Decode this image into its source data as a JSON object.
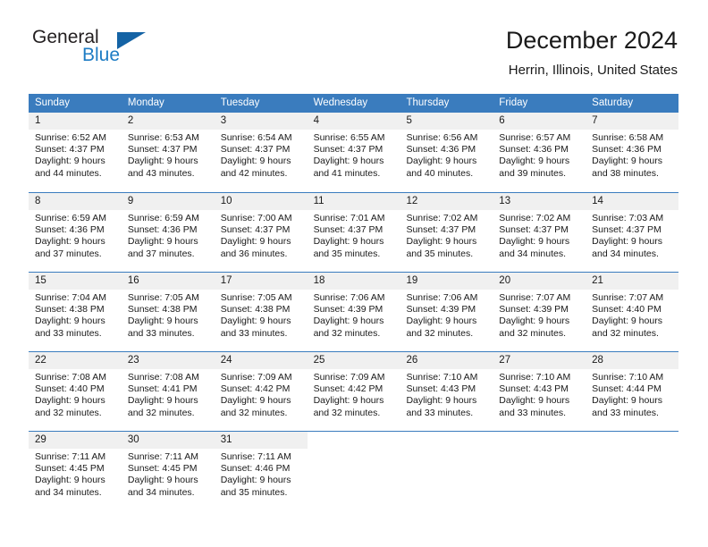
{
  "brand": {
    "name_part1": "General",
    "name_part2": "Blue",
    "logo_icon": "triangle-logo-icon",
    "accent_color": "#1463a5"
  },
  "header": {
    "title": "December 2024",
    "location": "Herrin, Illinois, United States"
  },
  "calendar": {
    "header_bg_color": "#3a7cbe",
    "day_band_color": "#f0f0f0",
    "weekdays": [
      "Sunday",
      "Monday",
      "Tuesday",
      "Wednesday",
      "Thursday",
      "Friday",
      "Saturday"
    ],
    "weeks": [
      [
        {
          "day": "1",
          "lines": [
            "Sunrise: 6:52 AM",
            "Sunset: 4:37 PM",
            "Daylight: 9 hours",
            "and 44 minutes."
          ]
        },
        {
          "day": "2",
          "lines": [
            "Sunrise: 6:53 AM",
            "Sunset: 4:37 PM",
            "Daylight: 9 hours",
            "and 43 minutes."
          ]
        },
        {
          "day": "3",
          "lines": [
            "Sunrise: 6:54 AM",
            "Sunset: 4:37 PM",
            "Daylight: 9 hours",
            "and 42 minutes."
          ]
        },
        {
          "day": "4",
          "lines": [
            "Sunrise: 6:55 AM",
            "Sunset: 4:37 PM",
            "Daylight: 9 hours",
            "and 41 minutes."
          ]
        },
        {
          "day": "5",
          "lines": [
            "Sunrise: 6:56 AM",
            "Sunset: 4:36 PM",
            "Daylight: 9 hours",
            "and 40 minutes."
          ]
        },
        {
          "day": "6",
          "lines": [
            "Sunrise: 6:57 AM",
            "Sunset: 4:36 PM",
            "Daylight: 9 hours",
            "and 39 minutes."
          ]
        },
        {
          "day": "7",
          "lines": [
            "Sunrise: 6:58 AM",
            "Sunset: 4:36 PM",
            "Daylight: 9 hours",
            "and 38 minutes."
          ]
        }
      ],
      [
        {
          "day": "8",
          "lines": [
            "Sunrise: 6:59 AM",
            "Sunset: 4:36 PM",
            "Daylight: 9 hours",
            "and 37 minutes."
          ]
        },
        {
          "day": "9",
          "lines": [
            "Sunrise: 6:59 AM",
            "Sunset: 4:36 PM",
            "Daylight: 9 hours",
            "and 37 minutes."
          ]
        },
        {
          "day": "10",
          "lines": [
            "Sunrise: 7:00 AM",
            "Sunset: 4:37 PM",
            "Daylight: 9 hours",
            "and 36 minutes."
          ]
        },
        {
          "day": "11",
          "lines": [
            "Sunrise: 7:01 AM",
            "Sunset: 4:37 PM",
            "Daylight: 9 hours",
            "and 35 minutes."
          ]
        },
        {
          "day": "12",
          "lines": [
            "Sunrise: 7:02 AM",
            "Sunset: 4:37 PM",
            "Daylight: 9 hours",
            "and 35 minutes."
          ]
        },
        {
          "day": "13",
          "lines": [
            "Sunrise: 7:02 AM",
            "Sunset: 4:37 PM",
            "Daylight: 9 hours",
            "and 34 minutes."
          ]
        },
        {
          "day": "14",
          "lines": [
            "Sunrise: 7:03 AM",
            "Sunset: 4:37 PM",
            "Daylight: 9 hours",
            "and 34 minutes."
          ]
        }
      ],
      [
        {
          "day": "15",
          "lines": [
            "Sunrise: 7:04 AM",
            "Sunset: 4:38 PM",
            "Daylight: 9 hours",
            "and 33 minutes."
          ]
        },
        {
          "day": "16",
          "lines": [
            "Sunrise: 7:05 AM",
            "Sunset: 4:38 PM",
            "Daylight: 9 hours",
            "and 33 minutes."
          ]
        },
        {
          "day": "17",
          "lines": [
            "Sunrise: 7:05 AM",
            "Sunset: 4:38 PM",
            "Daylight: 9 hours",
            "and 33 minutes."
          ]
        },
        {
          "day": "18",
          "lines": [
            "Sunrise: 7:06 AM",
            "Sunset: 4:39 PM",
            "Daylight: 9 hours",
            "and 32 minutes."
          ]
        },
        {
          "day": "19",
          "lines": [
            "Sunrise: 7:06 AM",
            "Sunset: 4:39 PM",
            "Daylight: 9 hours",
            "and 32 minutes."
          ]
        },
        {
          "day": "20",
          "lines": [
            "Sunrise: 7:07 AM",
            "Sunset: 4:39 PM",
            "Daylight: 9 hours",
            "and 32 minutes."
          ]
        },
        {
          "day": "21",
          "lines": [
            "Sunrise: 7:07 AM",
            "Sunset: 4:40 PM",
            "Daylight: 9 hours",
            "and 32 minutes."
          ]
        }
      ],
      [
        {
          "day": "22",
          "lines": [
            "Sunrise: 7:08 AM",
            "Sunset: 4:40 PM",
            "Daylight: 9 hours",
            "and 32 minutes."
          ]
        },
        {
          "day": "23",
          "lines": [
            "Sunrise: 7:08 AM",
            "Sunset: 4:41 PM",
            "Daylight: 9 hours",
            "and 32 minutes."
          ]
        },
        {
          "day": "24",
          "lines": [
            "Sunrise: 7:09 AM",
            "Sunset: 4:42 PM",
            "Daylight: 9 hours",
            "and 32 minutes."
          ]
        },
        {
          "day": "25",
          "lines": [
            "Sunrise: 7:09 AM",
            "Sunset: 4:42 PM",
            "Daylight: 9 hours",
            "and 32 minutes."
          ]
        },
        {
          "day": "26",
          "lines": [
            "Sunrise: 7:10 AM",
            "Sunset: 4:43 PM",
            "Daylight: 9 hours",
            "and 33 minutes."
          ]
        },
        {
          "day": "27",
          "lines": [
            "Sunrise: 7:10 AM",
            "Sunset: 4:43 PM",
            "Daylight: 9 hours",
            "and 33 minutes."
          ]
        },
        {
          "day": "28",
          "lines": [
            "Sunrise: 7:10 AM",
            "Sunset: 4:44 PM",
            "Daylight: 9 hours",
            "and 33 minutes."
          ]
        }
      ],
      [
        {
          "day": "29",
          "lines": [
            "Sunrise: 7:11 AM",
            "Sunset: 4:45 PM",
            "Daylight: 9 hours",
            "and 34 minutes."
          ]
        },
        {
          "day": "30",
          "lines": [
            "Sunrise: 7:11 AM",
            "Sunset: 4:45 PM",
            "Daylight: 9 hours",
            "and 34 minutes."
          ]
        },
        {
          "day": "31",
          "lines": [
            "Sunrise: 7:11 AM",
            "Sunset: 4:46 PM",
            "Daylight: 9 hours",
            "and 35 minutes."
          ]
        },
        {
          "day": "",
          "lines": []
        },
        {
          "day": "",
          "lines": []
        },
        {
          "day": "",
          "lines": []
        },
        {
          "day": "",
          "lines": []
        }
      ]
    ]
  }
}
